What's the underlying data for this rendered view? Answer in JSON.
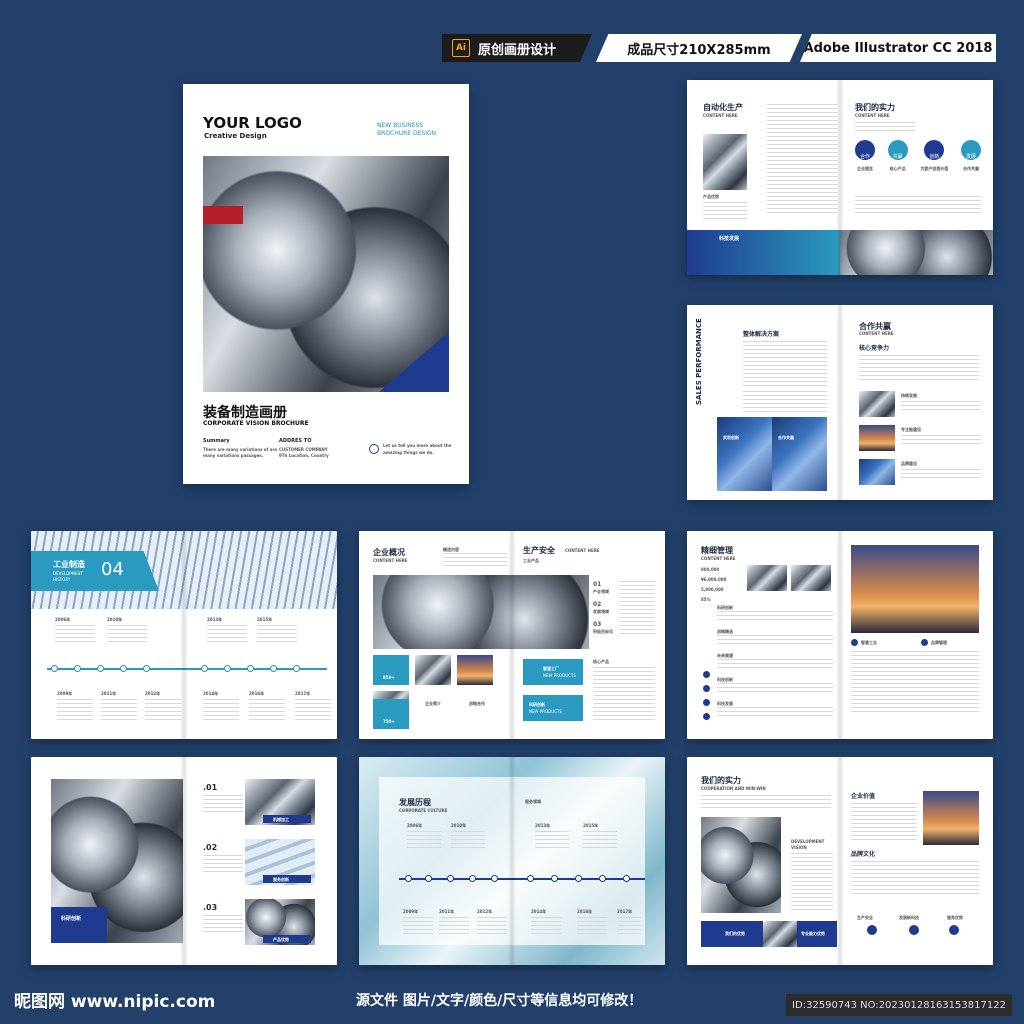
{
  "badges": {
    "ai_icon": "Ai",
    "design": "原创画册设计",
    "size": "成品尺寸210X285mm",
    "software": "Adobe Illustrator CC 2018"
  },
  "cover": {
    "logo": "YOUR LOGO",
    "logo_sub": "Creative Design",
    "tag1": "NEW BUSINESS",
    "tag2": "BROCHURE DESIGN",
    "title_cn": "装备制造画册",
    "title_en": "CORPORATE VISION BROCHURE",
    "summary_label": "Summary",
    "summary_text1": "There are many variations of  are",
    "summary_text2": "many variations passages.",
    "address_label": "ADDRES TO",
    "address_line1": "CUSTOMER COMPANY",
    "address_line2": "9Th Location, Country",
    "tell1": "Let us tell you more about the",
    "tell2": "amazing things we do."
  },
  "p1": {
    "left_title": "自动化生产",
    "left_sub": "CONTENT HERE",
    "left_caption": "产品优势",
    "bar_label": "科技发展",
    "right_title": "我们的实力",
    "right_sub": "CONTENT HERE",
    "circles": [
      "合作",
      "共赢",
      "创新",
      "发展"
    ],
    "circle_caps": [
      "企业理念",
      "核心产品",
      "为客户创造价值",
      "合作共赢"
    ]
  },
  "p2": {
    "vertical": "SALES PERFORMANCE",
    "left_title": "整体解决方案",
    "right_title": "合作共赢",
    "right_sub": "CONTENT HERE",
    "right_sub2": "核心竞争力",
    "img_labels": [
      "实现创新",
      "合作共赢"
    ],
    "list": [
      "持续发展",
      "专注能建设",
      "品牌建设"
    ]
  },
  "p3": {
    "label_cn": "工业制造",
    "label_en1": "DEVELOPMENT",
    "label_en2": "HISTORY",
    "number": "04",
    "years_top": [
      "2006年",
      "2010年",
      "2013年",
      "2015年"
    ],
    "years_bottom": [
      "2009年",
      "2011年",
      "2012年",
      "2014年",
      "2016年",
      "2017年"
    ]
  },
  "p4": {
    "left_title": "企业概况",
    "left_sub": "CONTENT HERE",
    "left_sub2": "概述内容",
    "right_title": "生产安全",
    "right_sub": "CONTENT HERE",
    "right_sub2": "工业产品",
    "stats": [
      "850+",
      "750+"
    ],
    "captions": [
      "企业简介",
      "战略合作"
    ],
    "nums": [
      "01",
      "02",
      "03"
    ],
    "num_labels": [
      "产业领域",
      "发展领域",
      "积极目标化"
    ],
    "core": "核心产品",
    "box1_cn": "智慧工厂",
    "box1_en": "NEW PRODUCTS",
    "box2_cn": "科研创新",
    "box2_en": "NEW PRODUCTS"
  },
  "p5": {
    "left_title": "精细管理",
    "left_sub": "CONTENT HERE",
    "stats": [
      "800,000",
      "¥6,000,000",
      "5,800,000",
      "85%"
    ],
    "items": [
      "科研创新",
      "战略精选",
      "未来展望",
      "科技创新",
      "科技发展"
    ],
    "right_caps": [
      "智慧工业",
      "品牌管理"
    ]
  },
  "p6": {
    "nums": [
      ".01",
      ".02",
      ".03"
    ],
    "img_labels": [
      "机械加工",
      "服务创新",
      "产品优势"
    ],
    "left_label": "科研创新"
  },
  "p7": {
    "title_cn": "发展历程",
    "title_en": "CORPORATE CULTURE",
    "right_label": "服务领域",
    "years_top": [
      "2006年",
      "2010年",
      "2013年",
      "2015年"
    ],
    "years_bottom": [
      "2009年",
      "2011年",
      "2012年",
      "2014年",
      "2016年",
      "2017年"
    ]
  },
  "p8": {
    "title_cn": "我们的实力",
    "title_en": "COOPERATION AND WIN-WIN",
    "dev1": "DEVELOPMENT",
    "dev2": "VISION",
    "bottom_labels": [
      "我们的优势",
      "专业能力优势"
    ],
    "right_title1": "企业价值",
    "right_title2": "品牌文化",
    "icons": [
      "生产安全",
      "发展新科技",
      "服务优势"
    ]
  },
  "footer": {
    "logo": "昵图网 www.nipic.com",
    "caption": "源文件 图片/文字/颜色/尺寸等信息均可修改！",
    "id": "ID:32590743 NO:20230128163153817122"
  },
  "colors": {
    "accent": "#2b9ac0",
    "navy": "#1f3b8f",
    "background": "#22406a"
  }
}
